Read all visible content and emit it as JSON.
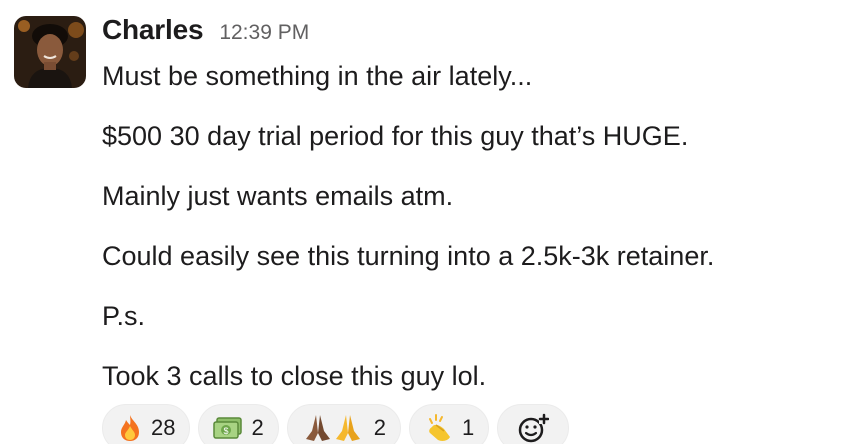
{
  "message": {
    "author": "Charles",
    "timestamp": "12:39 PM",
    "lines": [
      "Must be something in the air lately...",
      "$500 30 day trial period for this guy that’s HUGE.",
      "Mainly just wants emails atm.",
      "Could easily see this turning into a 2.5k-3k retainer.",
      "P.s.",
      "Took 3 calls to close this guy lol."
    ]
  },
  "reactions": [
    {
      "emoji": "fire-emoji",
      "count": "28"
    },
    {
      "emoji": "money-emoji",
      "count": "2"
    },
    {
      "emoji": "pray-emoji",
      "count": "2"
    },
    {
      "emoji": "clap-emoji",
      "count": "1"
    }
  ],
  "add_reaction_icon": "add-reaction-icon",
  "colors": {
    "text": "#1d1c1d",
    "timestamp": "#616061",
    "reaction_bg": "#f2f2f2"
  }
}
